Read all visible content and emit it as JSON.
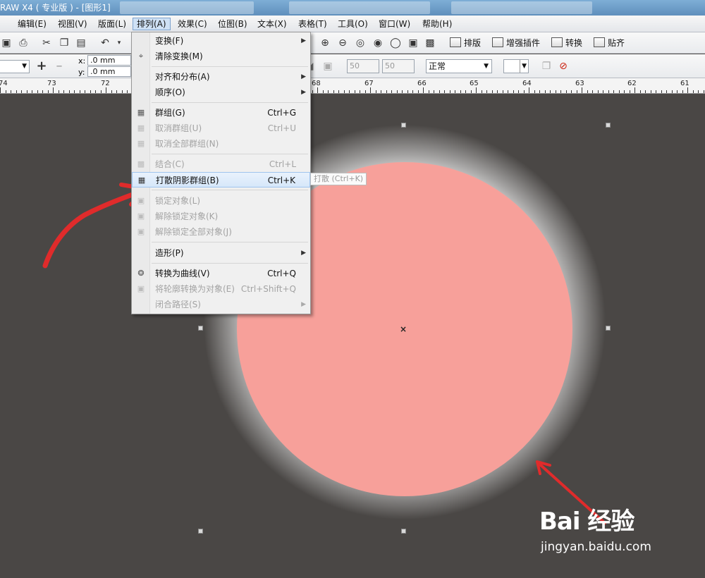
{
  "window": {
    "title": "RAW X4 ( 专业版 ) - [图形1]"
  },
  "menubar": {
    "items": [
      {
        "label": "编辑(E)"
      },
      {
        "label": "视图(V)"
      },
      {
        "label": "版面(L)"
      },
      {
        "label": "排列(A)"
      },
      {
        "label": "效果(C)"
      },
      {
        "label": "位图(B)"
      },
      {
        "label": "文本(X)"
      },
      {
        "label": "表格(T)"
      },
      {
        "label": "工具(O)"
      },
      {
        "label": "窗口(W)"
      },
      {
        "label": "帮助(H)"
      }
    ],
    "active": "排列(A)"
  },
  "toolbar": {
    "plugin_buttons": [
      {
        "label": "排版"
      },
      {
        "label": "增强插件"
      },
      {
        "label": "转换"
      },
      {
        "label": "贴齐"
      }
    ]
  },
  "propertybar": {
    "x_label": "x:",
    "x_value": ".0 mm",
    "y_label": "y:",
    "y_value": ".0 mm",
    "field1": "50",
    "field2": "50",
    "mode": "正常"
  },
  "ruler": {
    "labels": [
      "74",
      "73",
      "72",
      "68",
      "67",
      "66",
      "65",
      "64",
      "63",
      "62",
      "61"
    ]
  },
  "dropdown": {
    "items": [
      {
        "label": "变换(F)",
        "shortcut": "",
        "submenu": true,
        "disabled": false
      },
      {
        "label": "清除变换(M)",
        "shortcut": "",
        "submenu": false,
        "disabled": false
      },
      {
        "label": "对齐和分布(A)",
        "shortcut": "",
        "submenu": true,
        "disabled": false
      },
      {
        "label": "顺序(O)",
        "shortcut": "",
        "submenu": true,
        "disabled": false
      },
      {
        "label": "群组(G)",
        "shortcut": "Ctrl+G",
        "submenu": false,
        "disabled": false
      },
      {
        "label": "取消群组(U)",
        "shortcut": "Ctrl+U",
        "submenu": false,
        "disabled": true
      },
      {
        "label": "取消全部群组(N)",
        "shortcut": "",
        "submenu": false,
        "disabled": true
      },
      {
        "label": "结合(C)",
        "shortcut": "Ctrl+L",
        "submenu": false,
        "disabled": true
      },
      {
        "label": "打散阴影群组(B)",
        "shortcut": "Ctrl+K",
        "submenu": false,
        "disabled": false,
        "highlighted": true
      },
      {
        "label": "锁定对象(L)",
        "shortcut": "",
        "submenu": false,
        "disabled": true
      },
      {
        "label": "解除锁定对象(K)",
        "shortcut": "",
        "submenu": false,
        "disabled": true
      },
      {
        "label": "解除锁定全部对象(J)",
        "shortcut": "",
        "submenu": false,
        "disabled": true
      },
      {
        "label": "造形(P)",
        "shortcut": "",
        "submenu": true,
        "disabled": false
      },
      {
        "label": "转换为曲线(V)",
        "shortcut": "Ctrl+Q",
        "submenu": false,
        "disabled": false
      },
      {
        "label": "将轮廓转换为对象(E)",
        "shortcut": "Ctrl+Shift+Q",
        "submenu": false,
        "disabled": true
      },
      {
        "label": "闭合路径(S)",
        "shortcut": "",
        "submenu": true,
        "disabled": true
      }
    ]
  },
  "tooltip": {
    "text": "打散 (Ctrl+K)"
  },
  "canvas": {
    "background_color": "#4a4745",
    "circle_fill": "#f7a09a",
    "arrow_color": "#e02b2b"
  },
  "watermark": {
    "logo": "Bai 经验",
    "url": "jingyan.baidu.com"
  }
}
